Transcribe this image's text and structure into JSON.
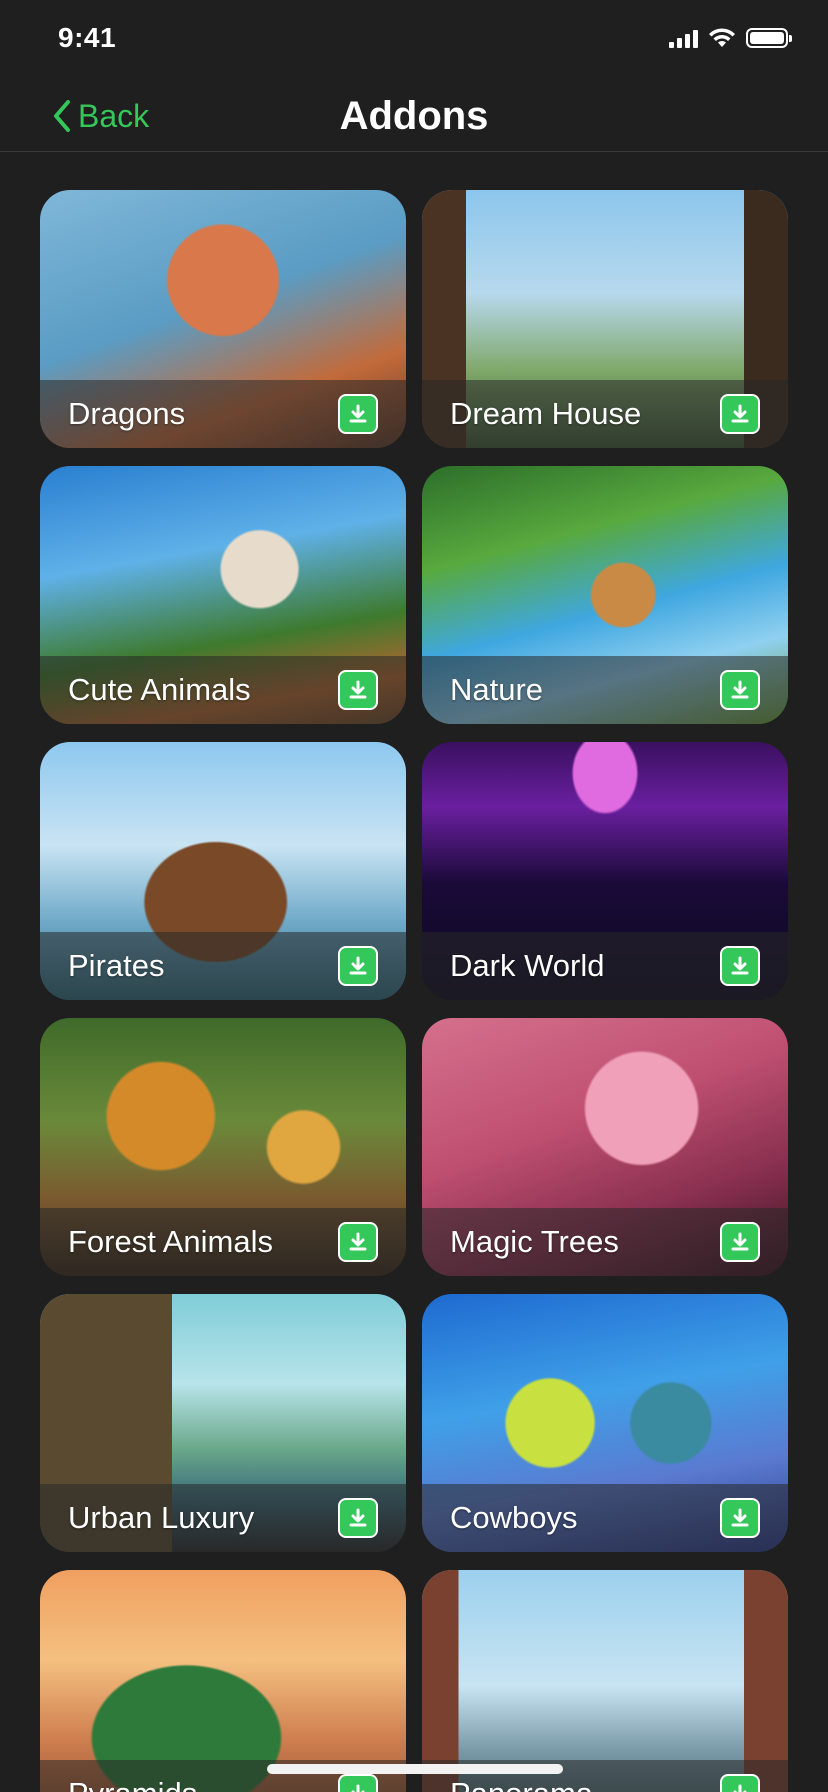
{
  "status_bar": {
    "time": "9:41"
  },
  "nav": {
    "back_label": "Back",
    "title": "Addons"
  },
  "cards": [
    {
      "title": "Dragons"
    },
    {
      "title": "Dream House"
    },
    {
      "title": "Cute Animals"
    },
    {
      "title": "Nature"
    },
    {
      "title": "Pirates"
    },
    {
      "title": "Dark World"
    },
    {
      "title": "Forest Animals"
    },
    {
      "title": "Magic Trees"
    },
    {
      "title": "Urban Luxury"
    },
    {
      "title": "Cowboys"
    },
    {
      "title": "Pyramids"
    },
    {
      "title": "Panorama"
    }
  ],
  "colors": {
    "accent": "#34c759",
    "background": "#1f1f1f"
  },
  "icons": {
    "back": "chevron-left-icon",
    "download": "download-icon"
  }
}
